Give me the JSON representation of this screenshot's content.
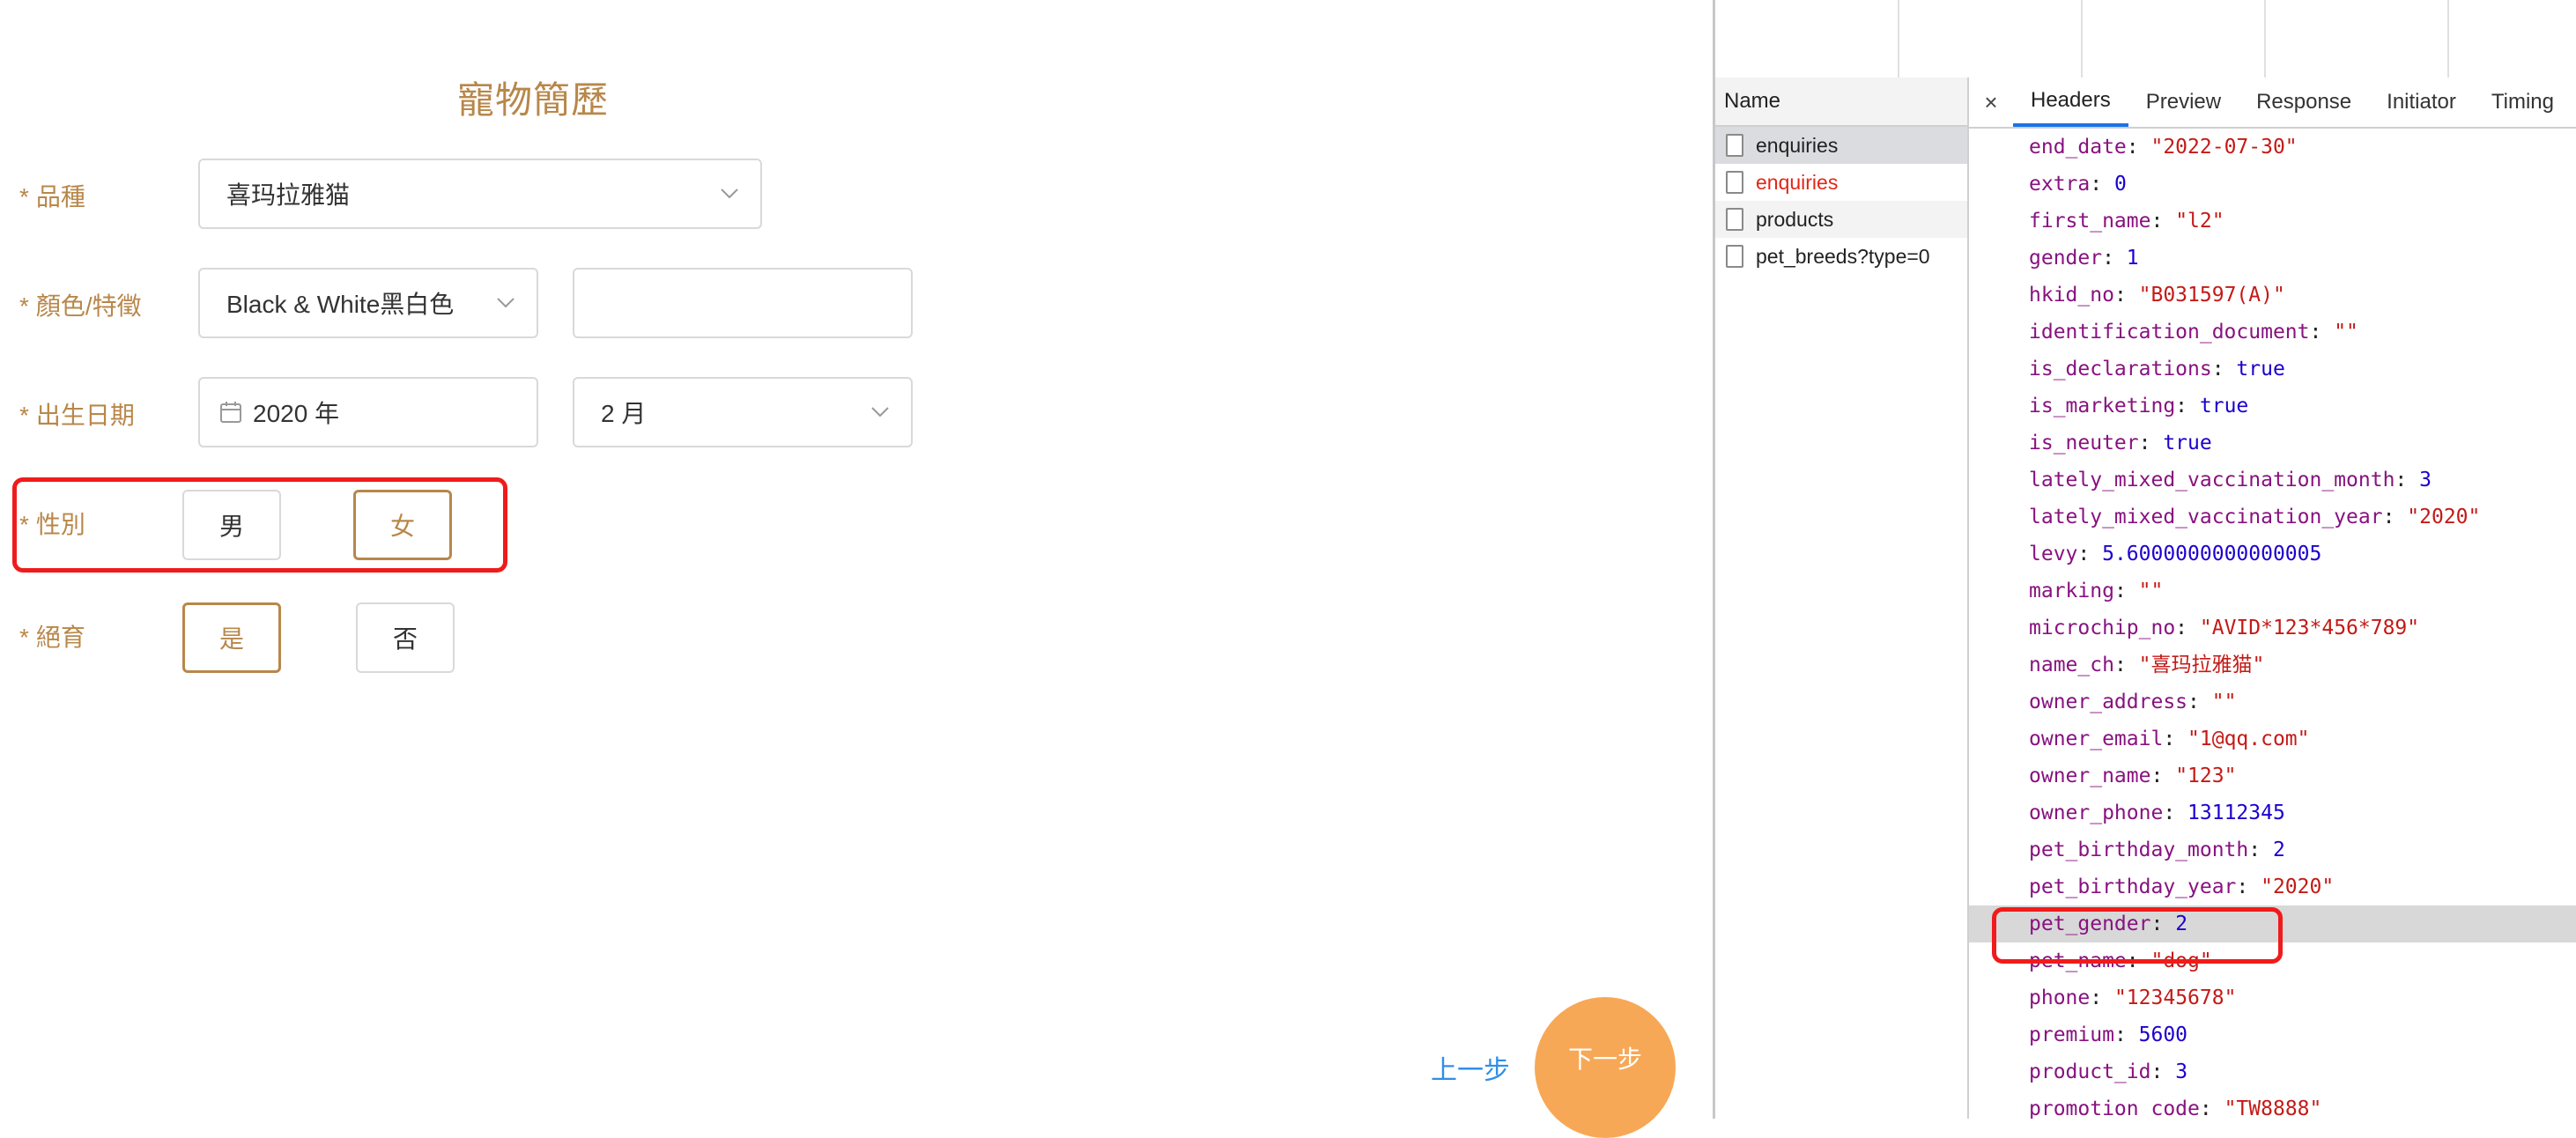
{
  "form": {
    "title": "寵物簡歷",
    "required_mark": "*",
    "breed": {
      "label": "品種",
      "value": "喜玛拉雅猫"
    },
    "color": {
      "label": "顏色/特徵",
      "value": "Black & White黑白色",
      "extra_value": ""
    },
    "birth": {
      "label": "出生日期",
      "year": "2020 年",
      "month": "2 月"
    },
    "gender": {
      "label": "性別",
      "options": [
        "男",
        "女"
      ],
      "selected": "女"
    },
    "neuter": {
      "label": "絕育",
      "options": [
        "是",
        "否"
      ],
      "selected": "是"
    },
    "prev_label": "上一步",
    "next_label": "下一步"
  },
  "devtools": {
    "name_header": "Name",
    "requests": [
      {
        "name": "enquiries",
        "state": "selected"
      },
      {
        "name": "enquiries",
        "state": "error"
      },
      {
        "name": "products",
        "state": "normal"
      },
      {
        "name": "pet_breeds?type=0",
        "state": "normal"
      }
    ],
    "close_glyph": "×",
    "tabs": [
      "Headers",
      "Preview",
      "Response",
      "Initiator",
      "Timing"
    ],
    "active_tab": "Headers",
    "payload": [
      {
        "key": "end_date",
        "value": "\"2022-07-30\"",
        "type": "string"
      },
      {
        "key": "extra",
        "value": "0",
        "type": "number"
      },
      {
        "key": "first_name",
        "value": "\"l2\"",
        "type": "string"
      },
      {
        "key": "gender",
        "value": "1",
        "type": "number"
      },
      {
        "key": "hkid_no",
        "value": "\"B031597(A)\"",
        "type": "string"
      },
      {
        "key": "identification_document",
        "value": "\"\"",
        "type": "string"
      },
      {
        "key": "is_declarations",
        "value": "true",
        "type": "bool"
      },
      {
        "key": "is_marketing",
        "value": "true",
        "type": "bool"
      },
      {
        "key": "is_neuter",
        "value": "true",
        "type": "bool"
      },
      {
        "key": "lately_mixed_vaccination_month",
        "value": "3",
        "type": "number"
      },
      {
        "key": "lately_mixed_vaccination_year",
        "value": "\"2020\"",
        "type": "string"
      },
      {
        "key": "levy",
        "value": "5.6000000000000005",
        "type": "number"
      },
      {
        "key": "marking",
        "value": "\"\"",
        "type": "string"
      },
      {
        "key": "microchip_no",
        "value": "\"AVID*123*456*789\"",
        "type": "string"
      },
      {
        "key": "name_ch",
        "value": "\"喜玛拉雅猫\"",
        "type": "string"
      },
      {
        "key": "owner_address",
        "value": "\"\"",
        "type": "string"
      },
      {
        "key": "owner_email",
        "value": "\"1@qq.com\"",
        "type": "string"
      },
      {
        "key": "owner_name",
        "value": "\"123\"",
        "type": "string"
      },
      {
        "key": "owner_phone",
        "value": "13112345",
        "type": "number"
      },
      {
        "key": "pet_birthday_month",
        "value": "2",
        "type": "number"
      },
      {
        "key": "pet_birthday_year",
        "value": "\"2020\"",
        "type": "string"
      },
      {
        "key": "pet_gender",
        "value": "2",
        "type": "number",
        "highlight": true
      },
      {
        "key": "pet_name",
        "value": "\"dog\"",
        "type": "string"
      },
      {
        "key": "phone",
        "value": "\"12345678\"",
        "type": "string"
      },
      {
        "key": "premium",
        "value": "5600",
        "type": "number"
      },
      {
        "key": "product_id",
        "value": "3",
        "type": "number"
      },
      {
        "key": "promotion_code",
        "value": "\"TW8888\"",
        "type": "string"
      }
    ]
  },
  "colors": {
    "form_accent": "#b8874a",
    "annotation_red": "#f01b1b",
    "next_button": "#f7a856",
    "link_blue": "#2f8fe8",
    "devtools_tab_active": "#1a73e8"
  }
}
